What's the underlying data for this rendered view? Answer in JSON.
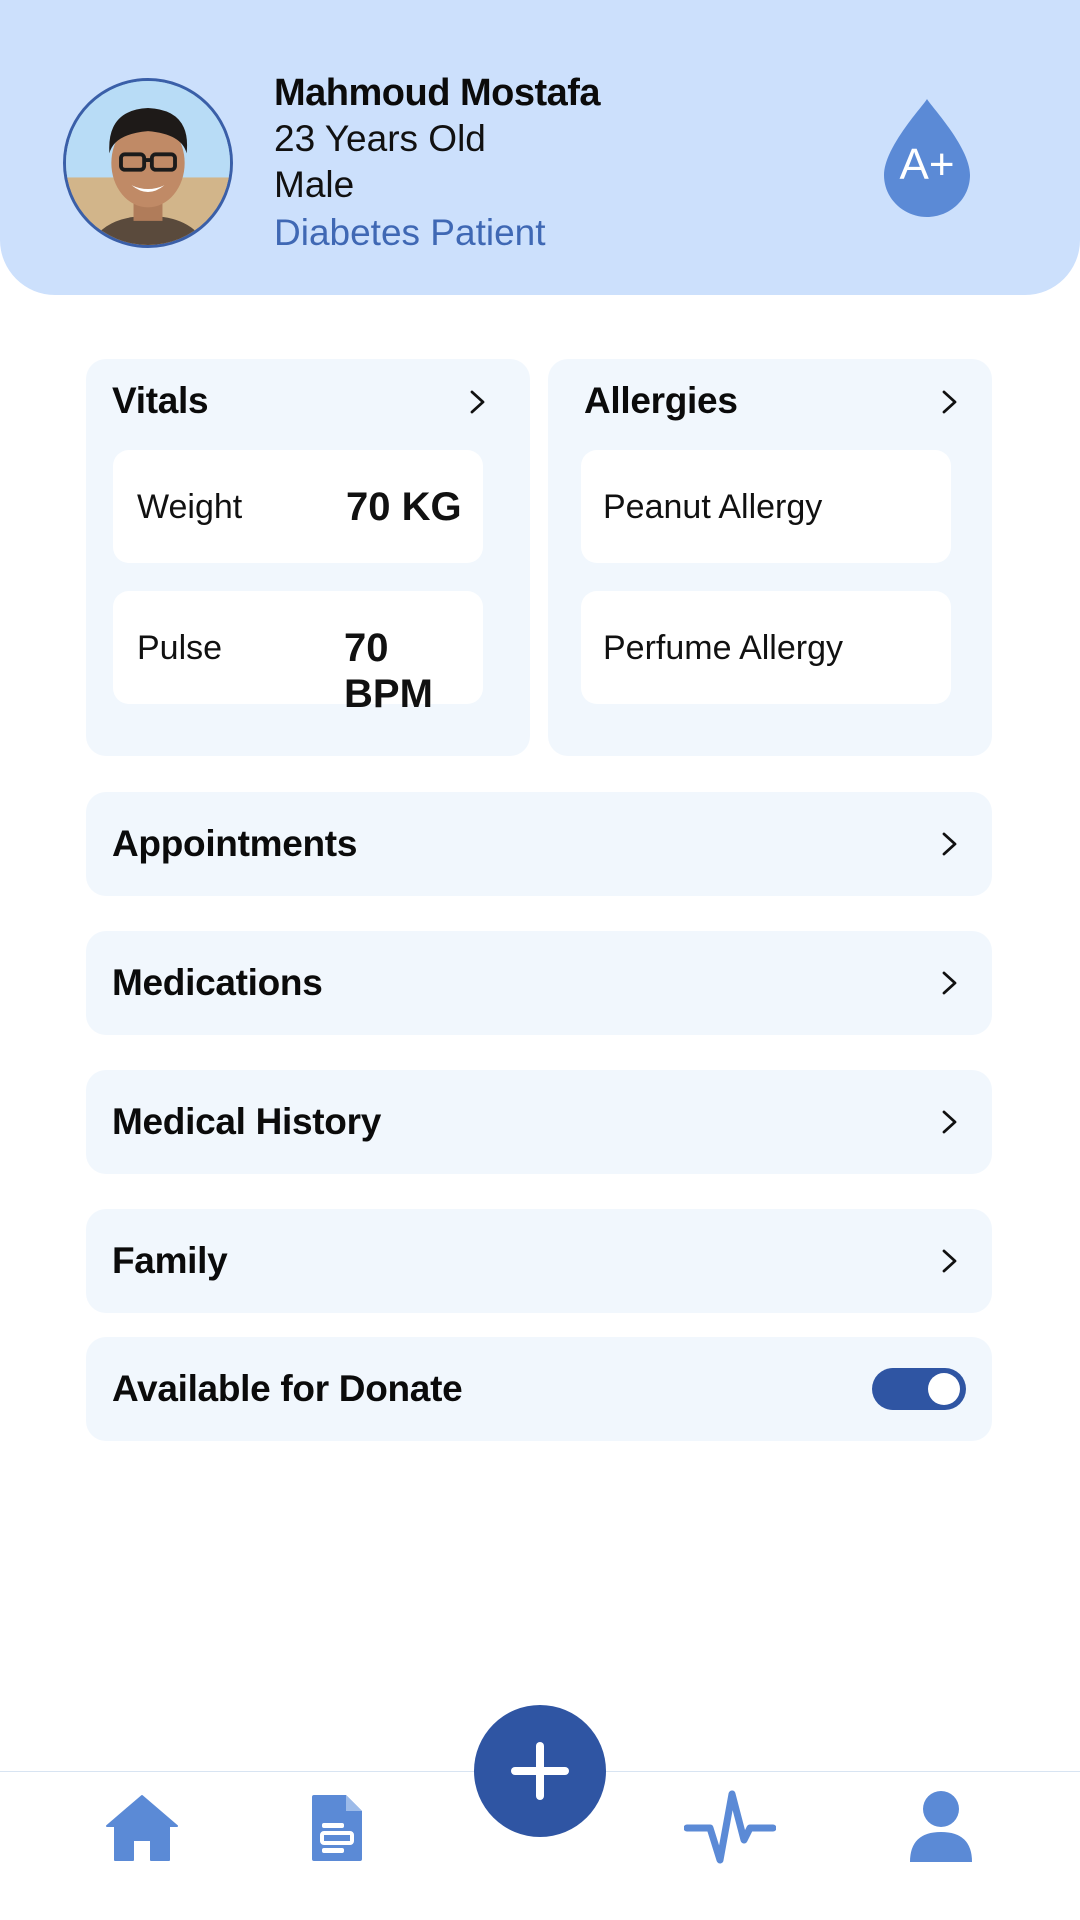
{
  "profile": {
    "name": "Mahmoud Mostafa",
    "age": "23 Years Old",
    "gender": "Male",
    "condition": "Diabetes Patient",
    "blood_type": "A+"
  },
  "vitals": {
    "title": "Vitals",
    "items": [
      {
        "label": "Weight",
        "value": "70 KG"
      },
      {
        "label": "Pulse",
        "value": "70 BPM"
      }
    ]
  },
  "allergies": {
    "title": "Allergies",
    "items": [
      "Peanut Allergy",
      "Perfume Allergy"
    ]
  },
  "sections": [
    {
      "label": "Appointments"
    },
    {
      "label": "Medications"
    },
    {
      "label": "Medical History"
    },
    {
      "label": "Family"
    }
  ],
  "donate": {
    "label": "Available for Donate",
    "enabled": true
  },
  "nav": {
    "items": [
      {
        "icon": "home-icon"
      },
      {
        "icon": "document-icon"
      },
      {
        "icon": "add-icon"
      },
      {
        "icon": "pulse-icon"
      },
      {
        "icon": "profile-icon"
      }
    ]
  },
  "colors": {
    "header_bg": "#cce0fc",
    "accent": "#2f55a3",
    "icon_blue": "#5b8ad6",
    "card_bg": "#f1f7fd",
    "condition_text": "#3f68b4"
  }
}
